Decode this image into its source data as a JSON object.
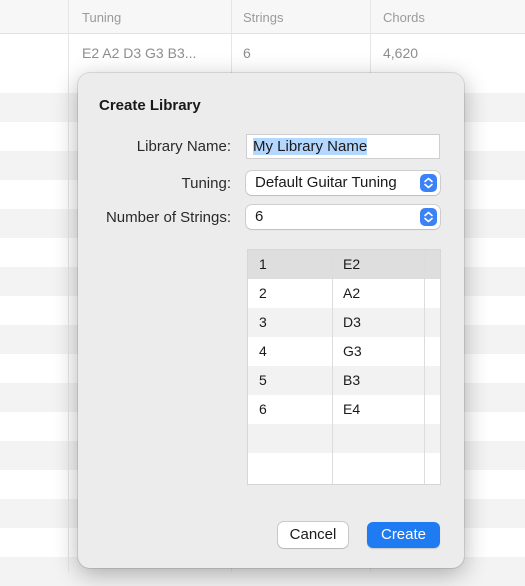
{
  "background_table": {
    "columns": [
      "Tuning",
      "Strings",
      "Chords"
    ],
    "row": [
      "E2 A2 D3 G3 B3...",
      "6",
      "4,620"
    ]
  },
  "dialog": {
    "title": "Create Library",
    "library_name_label": "Library Name:",
    "library_name_value": "My Library Name",
    "tuning_label": "Tuning:",
    "tuning_value": "Default Guitar Tuning",
    "strings_label": "Number of Strings:",
    "strings_value": "6",
    "strings_table": [
      {
        "string": "1",
        "note": "E2"
      },
      {
        "string": "2",
        "note": "A2"
      },
      {
        "string": "3",
        "note": "D3"
      },
      {
        "string": "4",
        "note": "G3"
      },
      {
        "string": "5",
        "note": "B3"
      },
      {
        "string": "6",
        "note": "E4"
      }
    ],
    "cancel_label": "Cancel",
    "create_label": "Create"
  },
  "colors": {
    "accent": "#1f7bf2",
    "selection": "#b4d7ff"
  },
  "icons": [
    "chevron-up-down-icon"
  ]
}
